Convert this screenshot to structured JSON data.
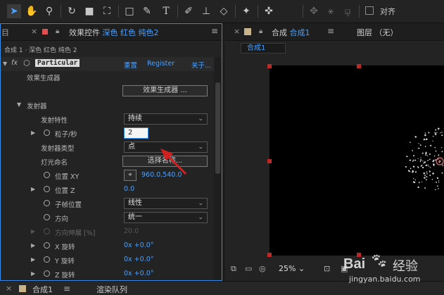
{
  "toolbar": {
    "tools": [
      {
        "icon": "selection-arrow-icon",
        "glyph": "➤"
      },
      {
        "icon": "hand-icon",
        "glyph": "✋"
      },
      {
        "icon": "zoom-icon",
        "glyph": "⚲"
      },
      {
        "icon": "rotate-icon",
        "glyph": "↻"
      },
      {
        "icon": "camera-icon",
        "glyph": "■"
      },
      {
        "icon": "pan-behind-icon",
        "glyph": "⛶"
      },
      {
        "icon": "rectangle-icon",
        "glyph": "□"
      },
      {
        "icon": "pen-icon",
        "glyph": "✎"
      },
      {
        "icon": "type-icon",
        "glyph": "T"
      },
      {
        "icon": "brush-icon",
        "glyph": "✐"
      },
      {
        "icon": "clone-stamp-icon",
        "glyph": "⊥"
      },
      {
        "icon": "eraser-icon",
        "glyph": "◇"
      },
      {
        "icon": "roto-brush-icon",
        "glyph": "✦"
      },
      {
        "icon": "puppet-pin-icon",
        "glyph": "✜"
      },
      {
        "icon": "axis-local-icon",
        "glyph": "✥"
      },
      {
        "icon": "axis-world-icon",
        "glyph": "⚹"
      },
      {
        "icon": "axis-view-icon",
        "glyph": "⚼"
      }
    ],
    "snap_label": "对齐"
  },
  "effects_panel": {
    "tab_prefix": "效果控件",
    "tab_highlight": "深色 红色 纯色2",
    "left_sep": "目",
    "breadcrumb": "合成 1 · 深色 红色 纯色 2",
    "fx_label": "fx",
    "plugin_name": "Particular",
    "links": {
      "reset": "重置",
      "register": "Register",
      "about": "关于..."
    },
    "rows": {
      "effect_builder_header": "效果生成器",
      "effect_builder_button": "效果生成器 ...",
      "emitter": "发射器",
      "emitter_behavior": {
        "label": "发射特性",
        "value": "持续"
      },
      "particles_per_sec": {
        "label": "粒子/秒",
        "value": "2"
      },
      "emitter_type": {
        "label": "发射器类型",
        "value": "点"
      },
      "light_naming": {
        "label": "灯光命名",
        "button": "选择名称..."
      },
      "position_xy": {
        "label": "位置 XY",
        "value": "960.0,540.0"
      },
      "position_z": {
        "label": "位置 Z",
        "value": "0.0"
      },
      "subframe_position": {
        "label": "子帧位置",
        "value": "线性"
      },
      "direction": {
        "label": "方向",
        "value": "统一"
      },
      "direction_spread": {
        "label": "方向伸展 [%]",
        "value": "20.0"
      },
      "x_rotation": {
        "label": "X 旋转",
        "value": "0x +0.0°"
      },
      "y_rotation": {
        "label": "Y 旋转",
        "value": "0x +0.0°"
      },
      "z_rotation": {
        "label": "Z 旋转",
        "value": "0x +0.0°"
      }
    }
  },
  "comp_panel": {
    "tab_prefix": "合成",
    "tab_highlight": "合成1",
    "layer_tab": "图层 （无）",
    "subtab": "合成1",
    "zoom": "25%"
  },
  "bottom": {
    "comp_tab": "合成1",
    "render_tab": "渲染队列"
  },
  "watermark": {
    "brand": "Bai",
    "brand2": "经验",
    "url": "jingyan.baidu.com"
  }
}
